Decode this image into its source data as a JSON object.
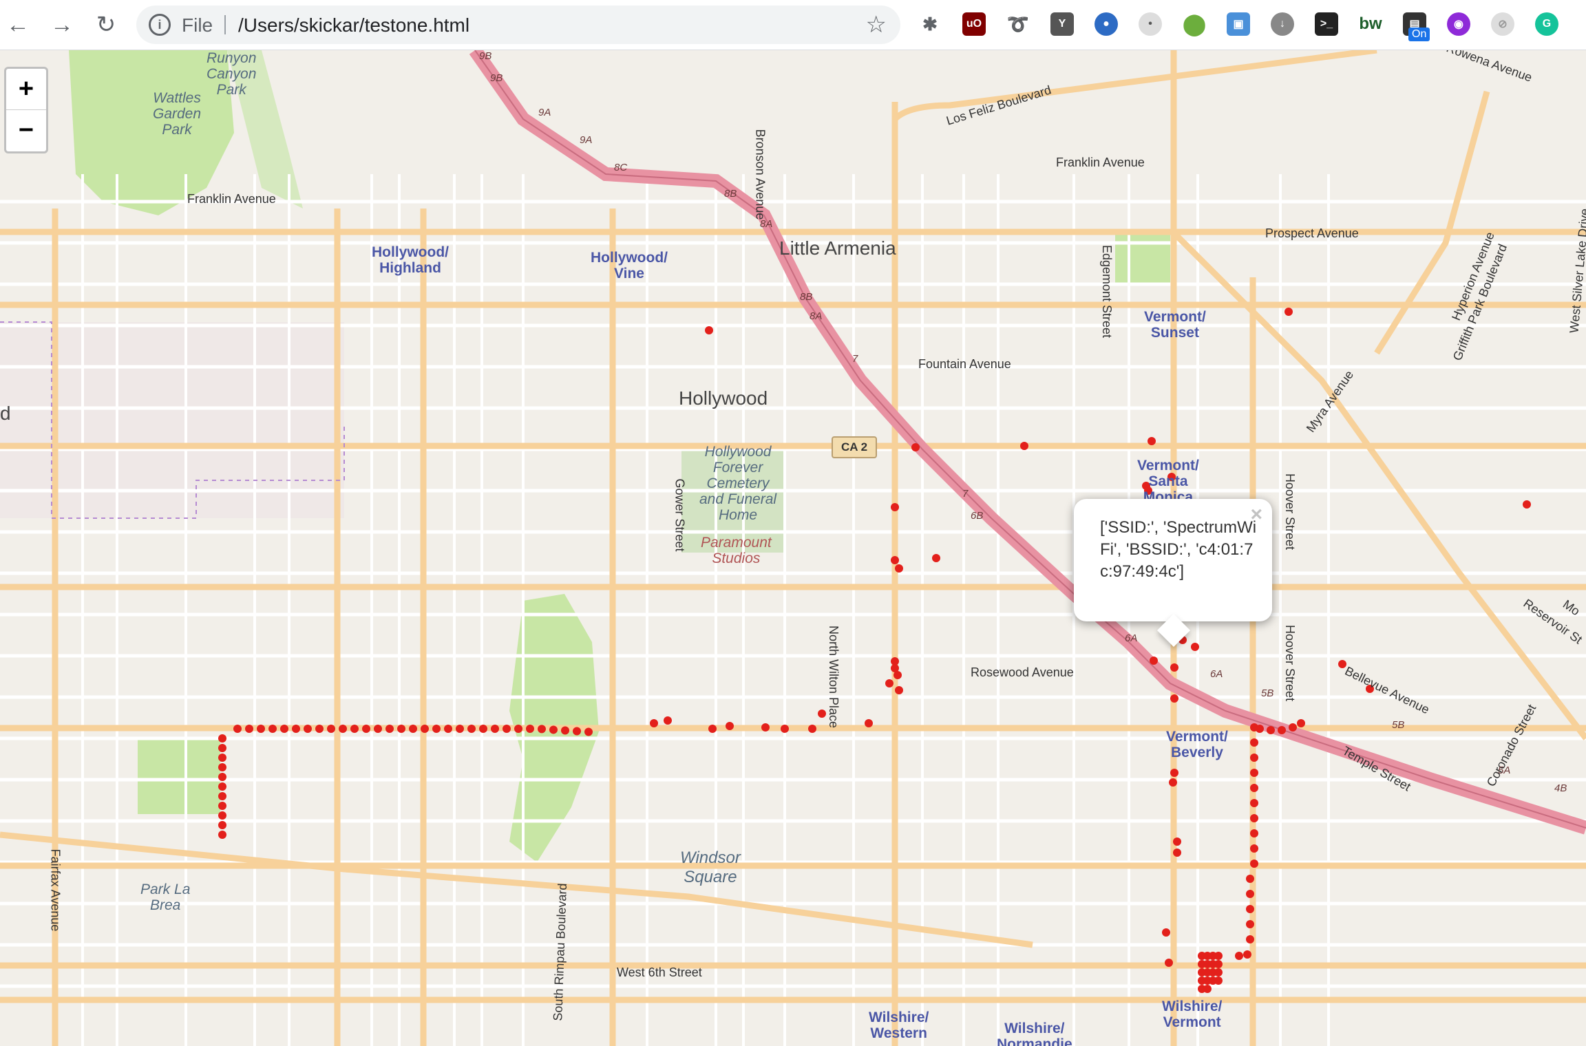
{
  "browser": {
    "url_scheme": "File",
    "url": "/Users/skickar/testone.html",
    "ext_badge": "On",
    "extensions": [
      "puzzle",
      "ublock",
      "lasso",
      "bookmark",
      "globe",
      "record",
      "maps",
      "camera",
      "download",
      "terminal",
      "bw",
      "screen",
      "orb",
      "dnd",
      "grammarly"
    ]
  },
  "map": {
    "zoom_in": "+",
    "zoom_out": "−",
    "popup": {
      "text": "['SSID:', 'SpectrumWiFi', 'BSSID:', 'c4:01:7c:97:49:4c']",
      "close": "×"
    },
    "colors": {
      "marker": "#e3201b",
      "freeway": "#e892a2",
      "major_road": "#f7d19a",
      "minor_road": "#ffffff",
      "park": "#c8e6a5"
    },
    "labels": {
      "runyon": [
        "Runyon",
        "Canyon",
        "Park"
      ],
      "wattles": [
        "Wattles",
        "Garden",
        "Park"
      ],
      "franklin_w": "Franklin Avenue",
      "franklin_e": "Franklin Avenue",
      "los_feliz": "Los Feliz Boulevard",
      "hollywood_highland": [
        "Hollywood/",
        "Highland"
      ],
      "hollywood_vine": [
        "Hollywood/",
        "Vine"
      ],
      "little_armenia": "Little Armenia",
      "bronson": "Bronson Avenue",
      "edgemont": "Edgemont Street",
      "prospect": "Prospect Avenue",
      "vermont_sunset": [
        "Vermont/",
        "Sunset"
      ],
      "hyperion": "Hyperion Avenue",
      "griffith": "Griffith Park Boulevard",
      "west_silver_lake": "West Silver Lake Drive",
      "rowena": "Rowena Avenue",
      "fountain": "Fountain Avenue",
      "hollywood": "Hollywood",
      "myra": "Myra Avenue",
      "ca2": "CA 2",
      "cemetery": [
        "Hollywood",
        "Forever",
        "Cemetery",
        "and Funeral",
        "Home"
      ],
      "paramount": [
        "Paramount",
        "Studios"
      ],
      "gower": "Gower Street",
      "vermont_santa_monica": [
        "Vermont/",
        "Santa",
        "Monica"
      ],
      "hoover1": "Hoover Street",
      "hoover2": "Hoover Street",
      "north_wilton": "North Wilton Place",
      "rosewood": "Rosewood Avenue",
      "vermont_beverly": [
        "Vermont/",
        "Beverly"
      ],
      "bellevue": "Bellevue Avenue",
      "reservoir": "Reservoir St",
      "temple": "Temple Street",
      "coronado": "Coronado Street",
      "windsor": [
        "Windsor",
        "Square"
      ],
      "park_la_brea": [
        "Park La",
        "Brea"
      ],
      "fairfax": "Fairfax Avenue",
      "south_rimpau": "South Rimpau Boulevard",
      "west_6th": "West 6th Street",
      "wilshire_western": [
        "Wilshire/",
        "Western"
      ],
      "wilshire_normandie": [
        "Wilshire/",
        "Normandie"
      ],
      "wilshire_vermont": [
        "Wilshire/",
        "Vermont"
      ],
      "left_edge": "d",
      "mo": "Mo",
      "exits": [
        "9B",
        "9B",
        "9A",
        "9A",
        "8C",
        "8B",
        "8A",
        "8B",
        "8A",
        "7",
        "7",
        "6B",
        "6A",
        "6A",
        "5B",
        "5B",
        "5A",
        "4B"
      ]
    }
  }
}
